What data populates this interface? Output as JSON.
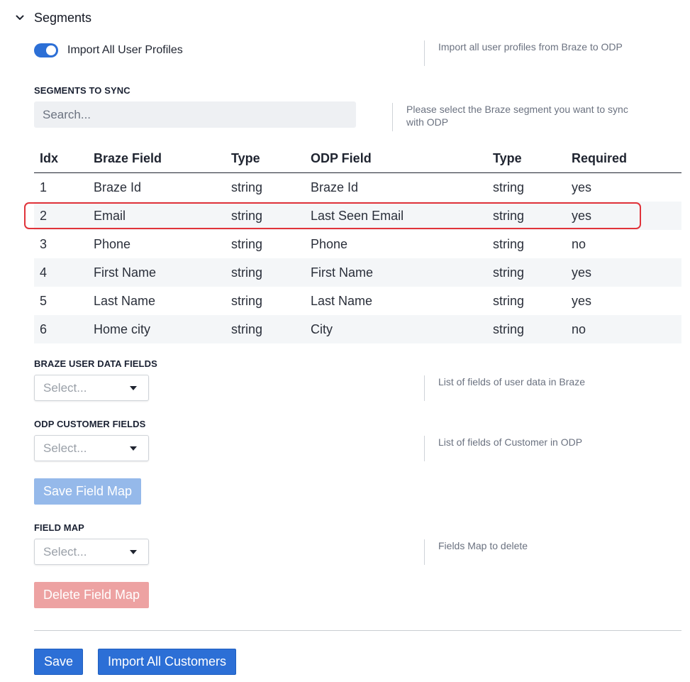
{
  "section": {
    "title": "Segments",
    "chevron_icon": "chevron-down-icon"
  },
  "import_profiles": {
    "label": "Import All User Profiles",
    "enabled": true,
    "help": "Import all user profiles from Braze to ODP"
  },
  "segments": {
    "label": "SEGMENTS TO SYNC",
    "placeholder": "Search...",
    "help_line1": "Please select the Braze segment you want to sync",
    "help_line2": "with ODP"
  },
  "table": {
    "headers": [
      "Idx",
      "Braze Field",
      "Type",
      "ODP Field",
      "Type",
      "Required"
    ],
    "rows": [
      [
        "1",
        "Braze Id",
        "string",
        "Braze Id",
        "string",
        "yes"
      ],
      [
        "2",
        "Email",
        "string",
        "Last Seen Email",
        "string",
        "yes"
      ],
      [
        "3",
        "Phone",
        "string",
        "Phone",
        "string",
        "no"
      ],
      [
        "4",
        "First Name",
        "string",
        "First Name",
        "string",
        "yes"
      ],
      [
        "5",
        "Last Name",
        "string",
        "Last Name",
        "string",
        "yes"
      ],
      [
        "6",
        "Home city",
        "string",
        "City",
        "string",
        "no"
      ]
    ]
  },
  "braze_fields": {
    "label": "BRAZE USER DATA FIELDS",
    "placeholder": "Select...",
    "help": "List of fields of user data in Braze"
  },
  "odp_fields": {
    "label": "ODP CUSTOMER FIELDS",
    "placeholder": "Select...",
    "help": "List of fields of Customer in ODP"
  },
  "save_field_map": {
    "label": "Save Field Map"
  },
  "field_map": {
    "label": "FIELD MAP",
    "placeholder": "Select...",
    "help": "Fields Map to delete"
  },
  "delete_field_map": {
    "label": "Delete Field Map"
  },
  "footer": {
    "save_label": "Save",
    "import_label": "Import All Customers"
  },
  "colors": {
    "primary": "#2c6fd6",
    "highlight": "#e0333a",
    "danger_disabled": "#eda2a2",
    "primary_disabled": "#95b9ea"
  }
}
